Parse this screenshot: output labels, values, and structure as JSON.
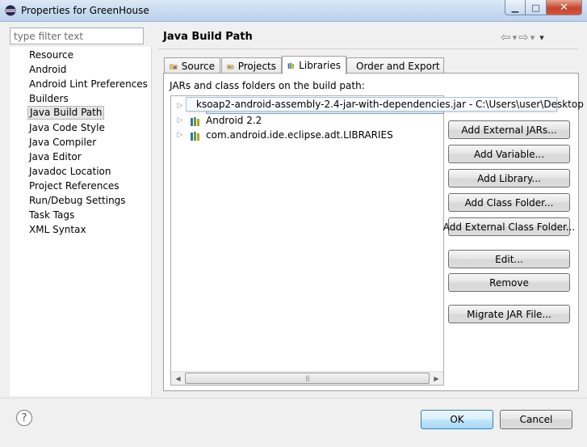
{
  "window": {
    "title": "Properties for GreenHouse",
    "icon": "eclipse-icon",
    "minimize_glyph": "▁",
    "maximize_glyph": "□",
    "close_glyph": "✕"
  },
  "filter": {
    "placeholder": "type filter text",
    "value": ""
  },
  "nav": {
    "items": [
      {
        "label": "Resource"
      },
      {
        "label": "Android"
      },
      {
        "label": "Android Lint Preferences"
      },
      {
        "label": "Builders"
      },
      {
        "label": "Java Build Path",
        "selected": true
      },
      {
        "label": "Java Code Style"
      },
      {
        "label": "Java Compiler"
      },
      {
        "label": "Java Editor"
      },
      {
        "label": "Javadoc Location"
      },
      {
        "label": "Project References"
      },
      {
        "label": "Run/Debug Settings"
      },
      {
        "label": "Task Tags"
      },
      {
        "label": "XML Syntax"
      }
    ]
  },
  "page": {
    "title": "Java Build Path",
    "back_glyph": "⇦",
    "forward_glyph": "⇨",
    "dropdown_glyph": "▾",
    "menu_glyph": "▾"
  },
  "tabs": [
    {
      "label": "Source",
      "icon": "source-folder-icon"
    },
    {
      "label": "Projects",
      "icon": "projects-folder-icon"
    },
    {
      "label": "Libraries",
      "icon": "libraries-icon",
      "active": true
    },
    {
      "label": "Order and Export",
      "icon": "order-export-icon"
    }
  ],
  "libraries": {
    "lead": "JARs and class folders on the build path:",
    "items": [
      {
        "label": "ksoap2-android-assembly-2.4-jar-with-dependencies.jar - C:\\Users\\user\\Desktop",
        "icon": "jar-icon",
        "selected": true
      },
      {
        "label": "Android 2.2",
        "icon": "library-icon"
      },
      {
        "label": "com.android.ide.eclipse.adt.LIBRARIES",
        "icon": "library-icon"
      }
    ],
    "expander_glyph": "▷",
    "scroll_left_glyph": "◀",
    "scroll_right_glyph": "▶",
    "scroll_grip": "|||"
  },
  "tooltip": {
    "text": "ksoap2-android-assembly-2.4-jar-with-dependencies.jar - C:\\Users\\user\\Desktop"
  },
  "buttons": {
    "add_external_jars": "Add External JARs...",
    "add_variable": "Add Variable...",
    "add_library": "Add Library...",
    "add_class_folder": "Add Class Folder...",
    "add_external_class_folder": "Add External Class Folder...",
    "edit": "Edit...",
    "remove": "Remove",
    "migrate_jar": "Migrate JAR File..."
  },
  "footer": {
    "help_glyph": "?",
    "ok": "OK",
    "cancel": "Cancel"
  },
  "colors": {
    "selection_border": "#7da2ce",
    "selection_fill": "#e8f2fc",
    "ok_border": "#3c7fb1"
  }
}
